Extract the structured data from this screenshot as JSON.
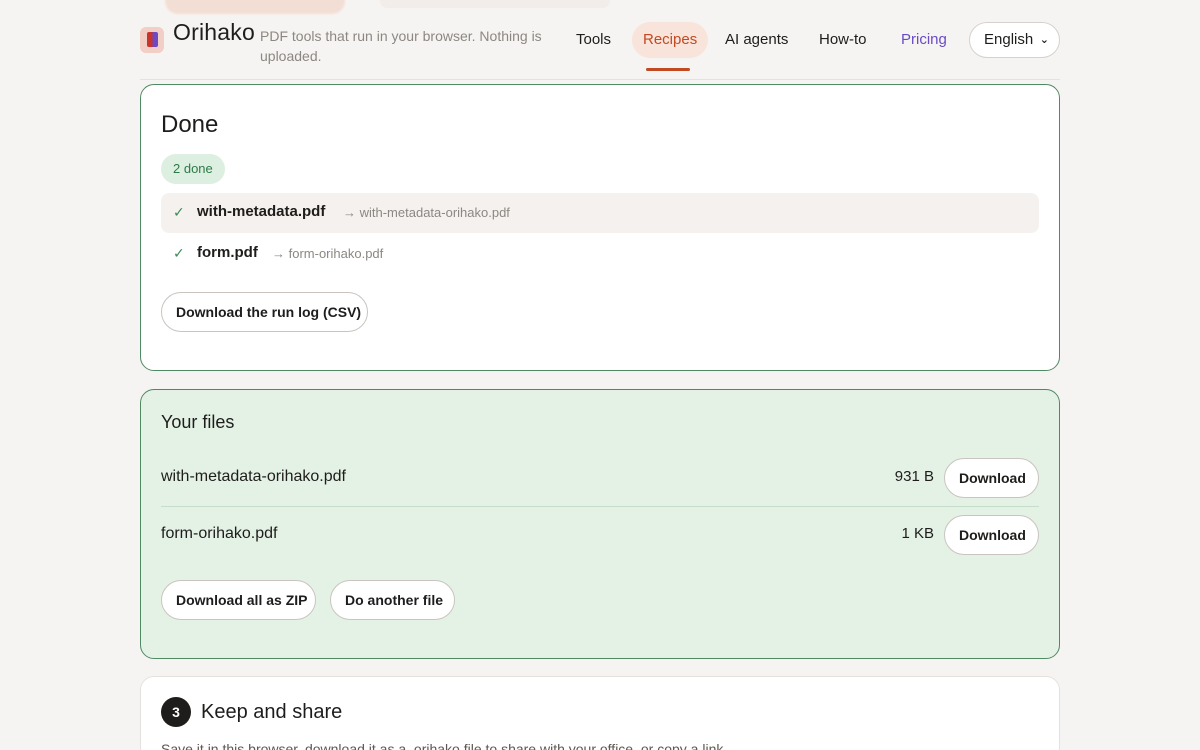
{
  "header": {
    "brand": "Orihako",
    "tagline": "PDF tools that run in your browser. Nothing is uploaded.",
    "nav": [
      {
        "label": "Tools"
      },
      {
        "label": "Recipes",
        "active": true
      },
      {
        "label": "AI agents"
      },
      {
        "label": "How-to"
      },
      {
        "label": "Pricing"
      }
    ],
    "language": "English"
  },
  "done": {
    "title": "Done",
    "badge": "2 done",
    "results": [
      {
        "input": "with-metadata.pdf",
        "output": "→ with-metadata-orihako.pdf"
      },
      {
        "input": "form.pdf",
        "output": "→ form-orihako.pdf"
      }
    ],
    "log_button": "Download the run log (CSV)"
  },
  "files": {
    "title": "Your files",
    "items": [
      {
        "name": "with-metadata-orihako.pdf",
        "size": "931 B",
        "action": "Download"
      },
      {
        "name": "form-orihako.pdf",
        "size": "1 KB",
        "action": "Download"
      }
    ],
    "zip_button": "Download all as ZIP",
    "another_button": "Do another file"
  },
  "share": {
    "step": "3",
    "title": "Keep and share",
    "description": "Save it in this browser, download it as a .orihako file to share with your office, or copy a link."
  },
  "colors": {
    "accent": "#c24a22",
    "success": "#2e7a4a",
    "files_bg": "#e4f2e6",
    "pricing": "#6a4bc4"
  }
}
